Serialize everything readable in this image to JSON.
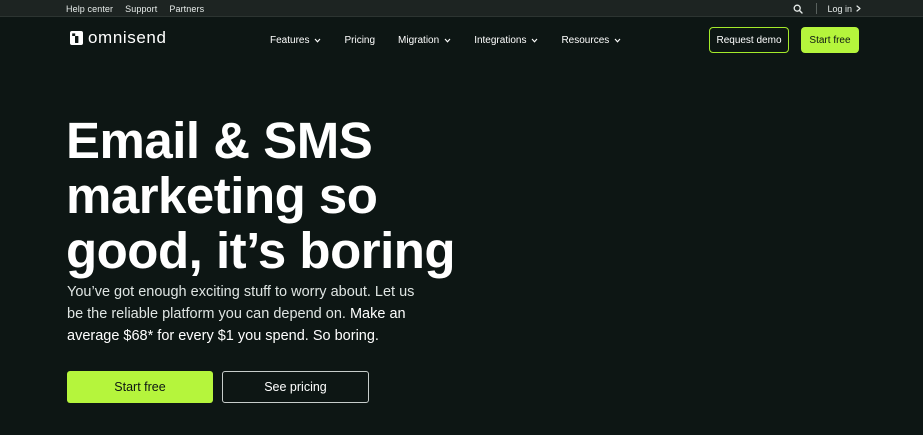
{
  "utility_bar": {
    "links": [
      "Help center",
      "Support",
      "Partners"
    ],
    "login_label": "Log in"
  },
  "brand": {
    "name": "omnisend",
    "logo_icon": "omnisend-logo-icon"
  },
  "nav": {
    "items": [
      {
        "label": "Features",
        "dropdown": true
      },
      {
        "label": "Pricing",
        "dropdown": false
      },
      {
        "label": "Migration",
        "dropdown": true
      },
      {
        "label": "Integrations",
        "dropdown": true
      },
      {
        "label": "Resources",
        "dropdown": true
      }
    ],
    "request_demo_label": "Request demo",
    "start_free_label": "Start free"
  },
  "hero": {
    "title_lines": [
      "Email & SMS",
      "marketing so",
      "good, it’s boring"
    ],
    "subtitle_plain": "You’ve got enough exciting stuff to worry about. Let us be the reliable platform you can depend on. ",
    "subtitle_emphasis": "Make an average $68* for every $1 you spend. So boring.",
    "primary_cta": "Start free",
    "secondary_cta": "See pricing"
  },
  "colors": {
    "background": "#0d1614",
    "utility_bar": "#1d2422",
    "accent": "#b5f53c",
    "text": "#ffffff"
  },
  "icons": {
    "search": "search-icon",
    "login_arrow": "chevron-right-icon",
    "dropdown": "chevron-down-icon"
  }
}
